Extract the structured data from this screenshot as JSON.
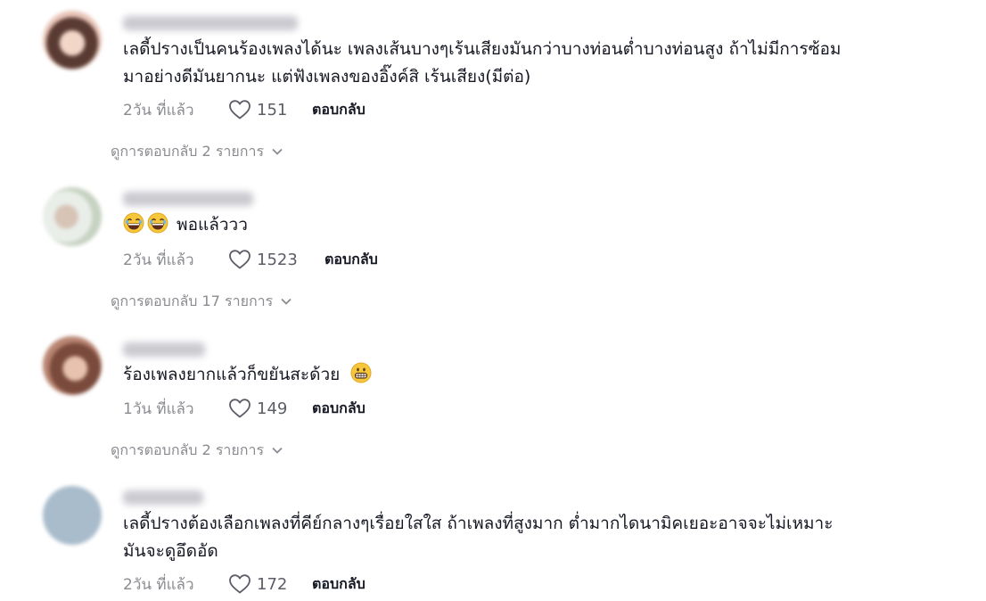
{
  "comments": [
    {
      "text_line1": "เลดี้ปรางเป็นคนร้องเพลงได้นะ เพลงเส้นบางๆเร้นเสียงมันกว่าบางท่อนต่ำบางท่อนสูง ถ้าไม่มีการซ้อม",
      "text_line2": "มาอย่างดีมันยากนะ แต่ฟังเพลงของอิ๊งค์สิ เร้นเสียง(มีต่อ)",
      "time": "2วัน ที่แล้ว",
      "likes": "151",
      "reply_label": "ตอบกลับ",
      "replies_label": "ดูการตอบกลับ 2 รายการ",
      "avatar_color": "#c9a59a"
    },
    {
      "text": "พอแล้ววว",
      "emoji_icons": [
        "laughing-emoji-icon",
        "laughing-emoji-icon"
      ],
      "time": "2วัน ที่แล้ว",
      "likes": "1523",
      "reply_label": "ตอบกลับ",
      "replies_label": "ดูการตอบกลับ 17 รายการ",
      "avatar_color": "#cfd6cc"
    },
    {
      "text": "ร้องเพลงยากแล้วก็ขยันสะด้วย",
      "emoji_icons": [
        "grinning-emoji-icon"
      ],
      "time": "1วัน ที่แล้ว",
      "likes": "149",
      "reply_label": "ตอบกลับ",
      "replies_label": "ดูการตอบกลับ 2 รายการ",
      "avatar_color": "#a9786a"
    },
    {
      "text_line1": "เลดี้ปรางต้องเลือกเพลงที่คีย์กลางๆเรื่อยใสใส ถ้าเพลงที่สูงมาก ต่ำมากไดนามิคเยอะอาจจะไม่เหมาะ",
      "text_line2": "มันจะดูอึดอัด",
      "time": "2วัน ที่แล้ว",
      "likes": "172",
      "reply_label": "ตอบกลับ",
      "avatar_color": "#a9bccb"
    }
  ]
}
